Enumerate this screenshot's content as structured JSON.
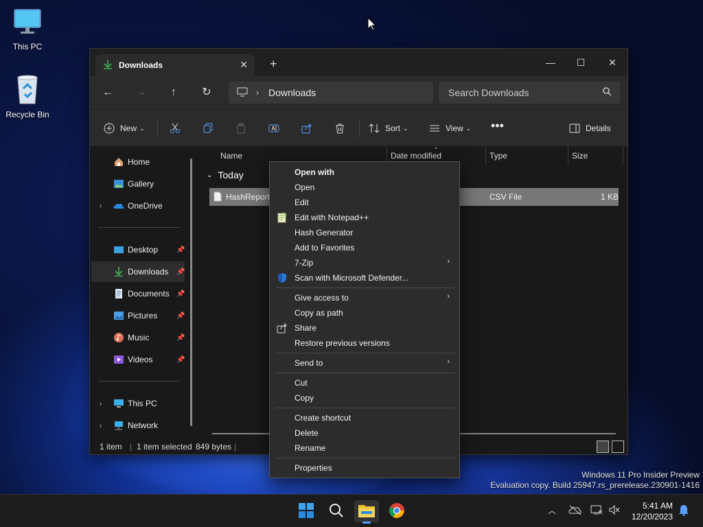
{
  "desktop": {
    "icons": [
      {
        "label": "This PC",
        "icon": "monitor-icon"
      },
      {
        "label": "Recycle Bin",
        "icon": "recycle-bin-icon"
      }
    ],
    "watermark_line1": "Windows 11 Pro Insider Preview",
    "watermark_line2": "Evaluation copy. Build 25947.rs_prerelease.230901-1416"
  },
  "window": {
    "tab_title": "Downloads",
    "address_crumb": "Downloads",
    "search_placeholder": "Search Downloads",
    "commands": {
      "new": "New",
      "sort": "Sort",
      "view": "View",
      "details": "Details"
    },
    "sidebar": {
      "items": [
        {
          "label": "Home",
          "icon": "home-icon"
        },
        {
          "label": "Gallery",
          "icon": "gallery-icon"
        },
        {
          "label": "OneDrive",
          "icon": "onedrive-icon"
        },
        {
          "label": "Desktop",
          "icon": "desktop-folder-icon"
        },
        {
          "label": "Downloads",
          "icon": "downloads-icon"
        },
        {
          "label": "Documents",
          "icon": "documents-icon"
        },
        {
          "label": "Pictures",
          "icon": "pictures-icon"
        },
        {
          "label": "Music",
          "icon": "music-icon"
        },
        {
          "label": "Videos",
          "icon": "videos-icon"
        },
        {
          "label": "This PC",
          "icon": "this-pc-icon"
        },
        {
          "label": "Network",
          "icon": "network-icon"
        }
      ]
    },
    "columns": {
      "name": "Name",
      "date_modified": "Date modified",
      "type": "Type",
      "size": "Size"
    },
    "group_label": "Today",
    "file": {
      "name": "HashReport.",
      "type": "CSV File",
      "size": "1 KB"
    },
    "status": {
      "count": "1 item",
      "selected": "1 item selected",
      "size": "849 bytes"
    }
  },
  "context_menu": {
    "items": [
      "Open with",
      "Open",
      "Edit",
      "Edit with Notepad++",
      "Hash Generator",
      "Add to Favorites",
      "7-Zip",
      "Scan with Microsoft Defender...",
      "Give access to",
      "Copy as path",
      "Share",
      "Restore previous versions",
      "Send to",
      "Cut",
      "Copy",
      "Create shortcut",
      "Delete",
      "Rename",
      "Properties"
    ]
  },
  "taskbar": {
    "time": "5:41 AM",
    "date": "12/20/2023"
  },
  "colors": {
    "accent": "#5aa0ff",
    "downloads_green": "#3fb950",
    "window_bg": "#191919",
    "menu_bg": "#2c2c2c"
  }
}
